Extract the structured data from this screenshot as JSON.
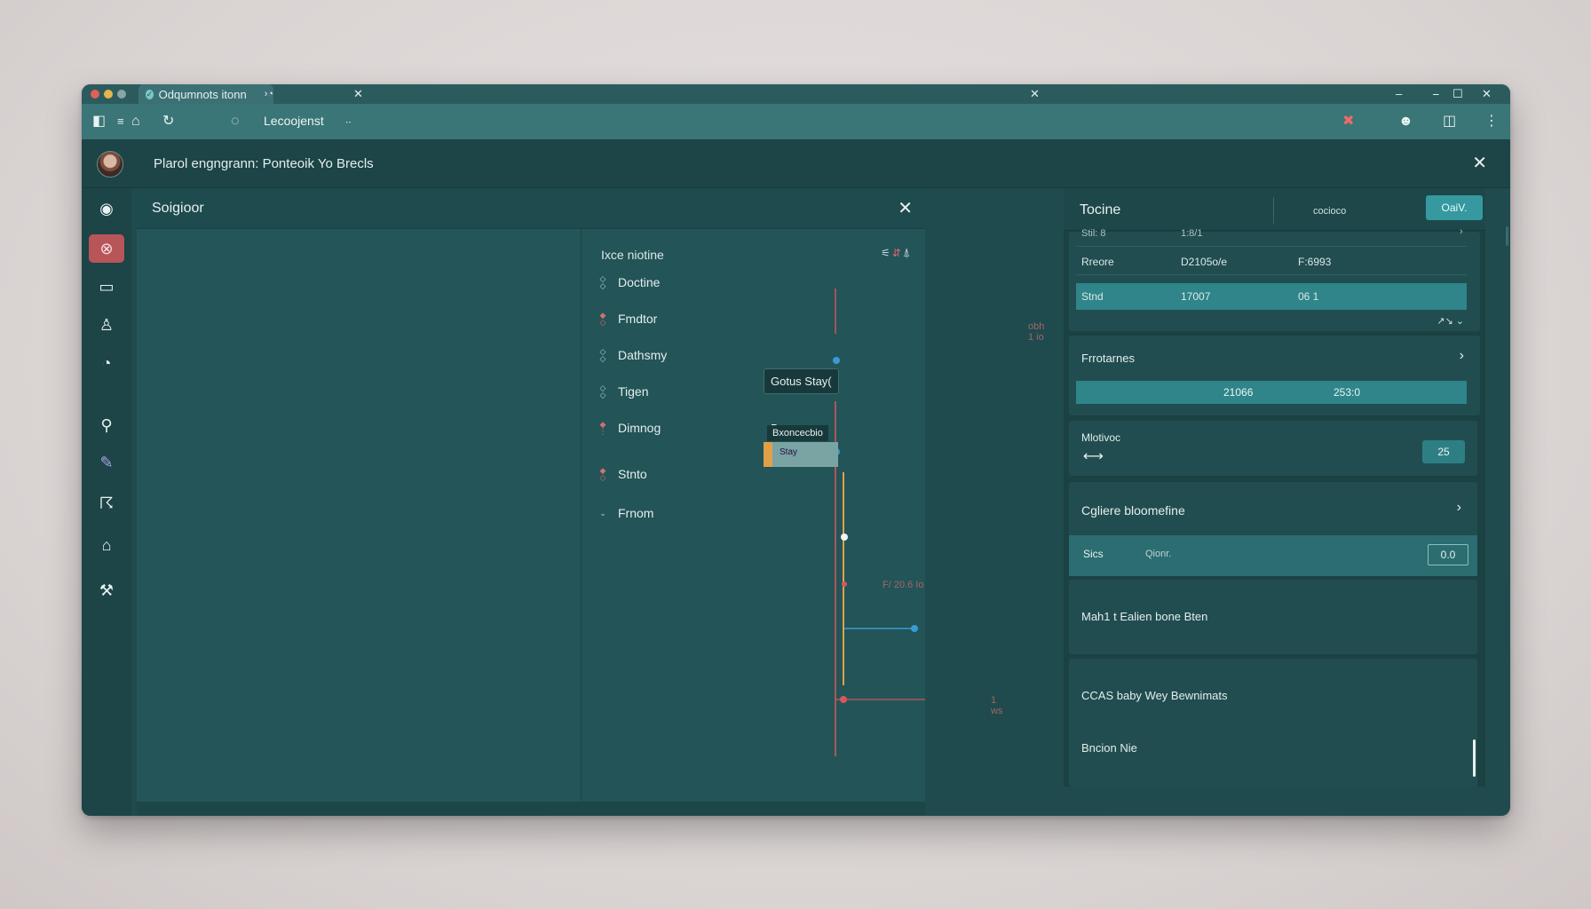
{
  "browser": {
    "tab_title": "Odqumnots itonn",
    "tab_extra": "×",
    "url_text": "Lecoojenst",
    "url_extra": "∙∙"
  },
  "header": {
    "title": "Plarol engngrann:  Ponteoik Yo Brecls"
  },
  "main": {
    "title": "Soigioor",
    "timeline_title": "Ixce niotine",
    "tracks": [
      {
        "label": "Doctine"
      },
      {
        "label": "Fmdtor"
      },
      {
        "label": "Dathsmy"
      },
      {
        "label": "Tigen"
      },
      {
        "label": "Dimnog"
      },
      {
        "label": "Stnto"
      },
      {
        "label": "Frnom"
      }
    ],
    "tooltip": "Gotus Stay(",
    "dimnog_value": "Bnon",
    "sublabel": "Bxoncecbio",
    "bar_text": "Stay",
    "faint_top": "obh 1 io",
    "faint_mid": "F/ 20.6 Io",
    "faint_low": "1 ws"
  },
  "right": {
    "title": "Tocine",
    "subtitle": "cocioco",
    "button": "OaiV.",
    "table": {
      "partial_row": [
        "Stil: 8",
        "1:8/1"
      ],
      "rows": [
        [
          "Rreore",
          "D2105o/e",
          "F:6993"
        ],
        [
          "Stnd",
          "17007",
          "06 1"
        ]
      ],
      "footer": "↗↘  ⌄"
    },
    "preferences": {
      "title": "Frrotarnes",
      "values": [
        "21066",
        "253:0"
      ]
    },
    "motor": {
      "title": "Mlotivoc",
      "arrow": "⟷",
      "value": "25"
    },
    "cgliere": {
      "title": "Cgliere  bloomefine",
      "row_label": "Sics",
      "row_value": "Qionr.",
      "row_input": "0.0"
    },
    "item1": "Mah1 t  Ealien bone Bten",
    "item2": "CCAS  baby Wey  Bewnimats",
    "item3": "Bncion Nie"
  },
  "colors": {
    "accent": "#35999f",
    "marker_red": "#d9565c",
    "marker_orange": "#e0a04a",
    "marker_blue": "#3a9bd4"
  }
}
